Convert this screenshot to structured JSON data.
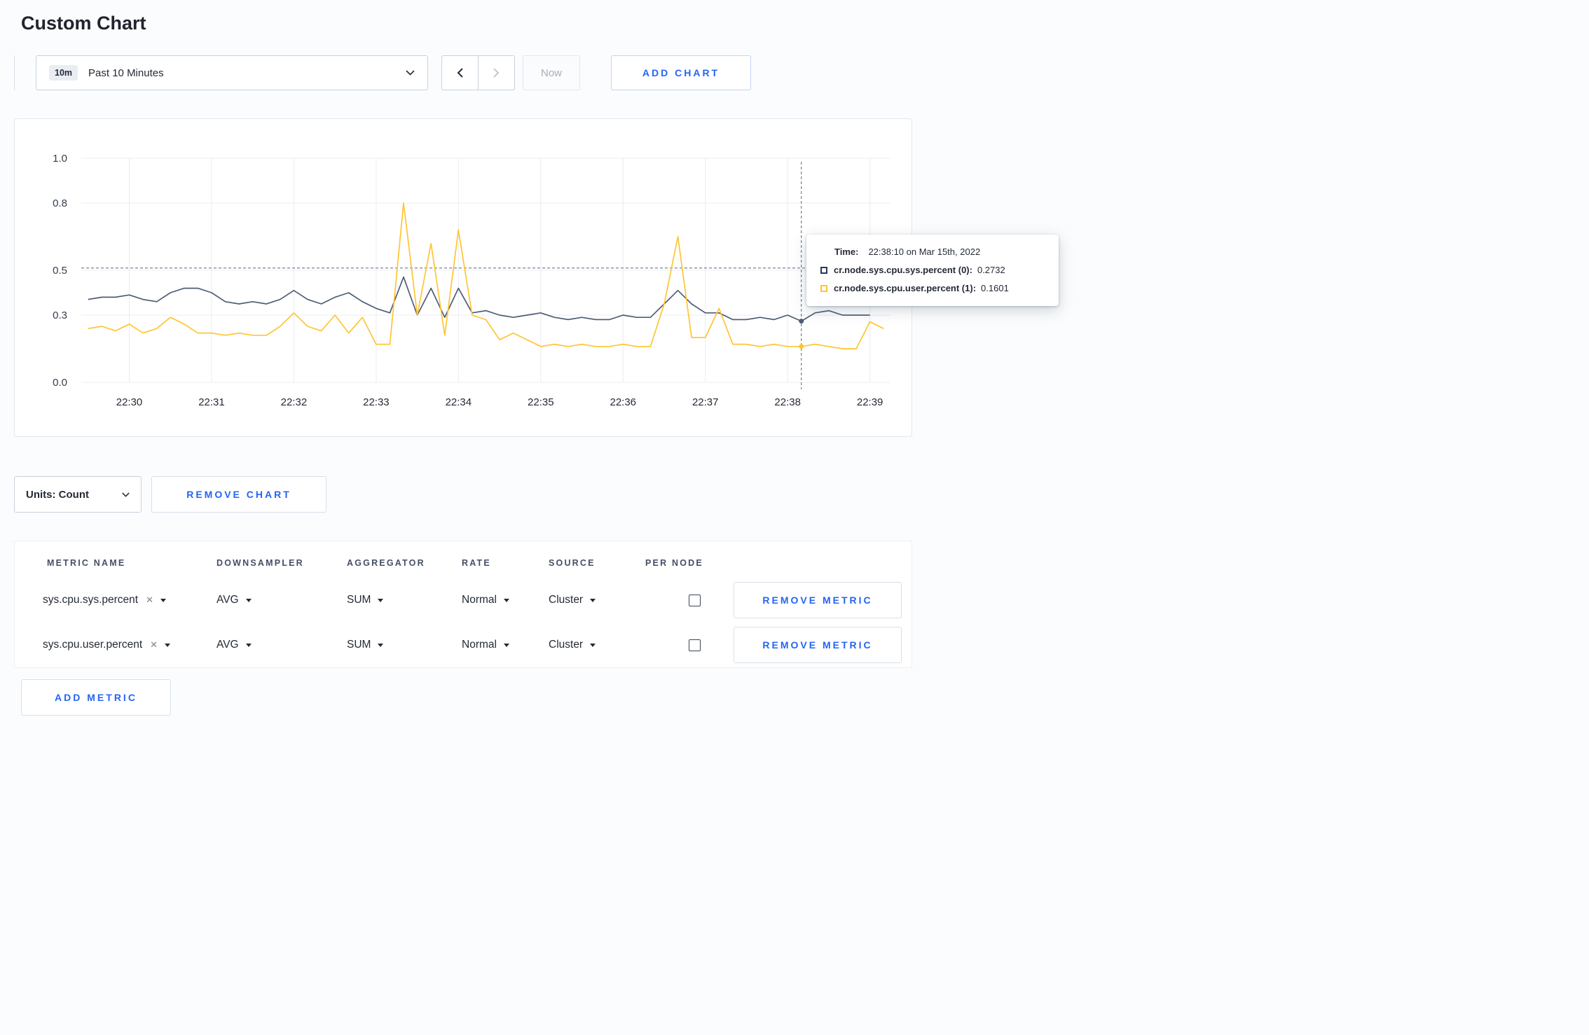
{
  "page": {
    "title": "Custom Chart"
  },
  "toolbar": {
    "time_window_badge": "10m",
    "time_window_label": "Past 10 Minutes",
    "now_label": "Now",
    "add_chart_label": "ADD CHART"
  },
  "chart_card": {
    "units_label": "Units: Count",
    "remove_chart_label": "REMOVE CHART",
    "tooltip": {
      "time_label": "Time:",
      "time_value": "22:38:10 on Mar 15th, 2022",
      "series": [
        {
          "label": "cr.node.sys.cpu.sys.percent (0):",
          "value": "0.2732",
          "color": "#283a57"
        },
        {
          "label": "cr.node.sys.cpu.user.percent (1):",
          "value": "0.1601",
          "color": "#ffc533"
        }
      ]
    }
  },
  "chart_data": {
    "type": "line",
    "title": "",
    "xlabel": "",
    "ylabel": "",
    "ylim": [
      0,
      1
    ],
    "yticks": [
      0.0,
      0.3,
      0.5,
      0.8,
      1.0
    ],
    "ytick_labels": [
      "0.0",
      "0.3",
      "0.5",
      "0.8",
      "1.0"
    ],
    "xticks": [
      "22:30",
      "22:31",
      "22:32",
      "22:33",
      "22:34",
      "22:35",
      "22:36",
      "22:37",
      "22:38",
      "22:39"
    ],
    "x_domain": [
      "22:29:25",
      "22:39:15"
    ],
    "grid": true,
    "legend_position": "none",
    "x": [
      "22:29:30",
      "22:29:40",
      "22:29:50",
      "22:30:00",
      "22:30:10",
      "22:30:20",
      "22:30:30",
      "22:30:40",
      "22:30:50",
      "22:31:00",
      "22:31:10",
      "22:31:20",
      "22:31:30",
      "22:31:40",
      "22:31:50",
      "22:32:00",
      "22:32:10",
      "22:32:20",
      "22:32:30",
      "22:32:40",
      "22:32:50",
      "22:33:00",
      "22:33:10",
      "22:33:20",
      "22:33:30",
      "22:33:40",
      "22:33:50",
      "22:34:00",
      "22:34:10",
      "22:34:20",
      "22:34:30",
      "22:34:40",
      "22:34:50",
      "22:35:00",
      "22:35:10",
      "22:35:20",
      "22:35:30",
      "22:35:40",
      "22:35:50",
      "22:36:00",
      "22:36:10",
      "22:36:20",
      "22:36:30",
      "22:36:40",
      "22:36:50",
      "22:37:00",
      "22:37:10",
      "22:37:20",
      "22:37:30",
      "22:37:40",
      "22:37:50",
      "22:38:00",
      "22:38:10",
      "22:38:20",
      "22:38:30",
      "22:38:40",
      "22:38:50",
      "22:39:00",
      "22:39:10"
    ],
    "series": [
      {
        "name": "cr.node.sys.cpu.sys.percent",
        "color": "#4f5d75",
        "values": [
          0.37,
          0.38,
          0.38,
          0.39,
          0.37,
          0.36,
          0.4,
          0.42,
          0.42,
          0.4,
          0.36,
          0.35,
          0.36,
          0.35,
          0.37,
          0.41,
          0.37,
          0.35,
          0.38,
          0.4,
          0.36,
          0.33,
          0.31,
          0.47,
          0.3,
          0.42,
          0.29,
          0.42,
          0.31,
          0.32,
          0.3,
          0.29,
          0.3,
          0.31,
          0.29,
          0.28,
          0.29,
          0.28,
          0.28,
          0.3,
          0.29,
          0.29,
          0.35,
          0.41,
          0.35,
          0.31,
          0.31,
          0.28,
          0.28,
          0.29,
          0.28,
          0.3,
          0.2732,
          0.31,
          0.32,
          0.3,
          0.3,
          0.3,
          null
        ]
      },
      {
        "name": "cr.node.sys.cpu.user.percent",
        "color": "#ffc533",
        "values": [
          0.24,
          0.25,
          0.23,
          0.26,
          0.22,
          0.24,
          0.29,
          0.26,
          0.22,
          0.22,
          0.21,
          0.22,
          0.21,
          0.21,
          0.25,
          0.31,
          0.25,
          0.23,
          0.3,
          0.22,
          0.29,
          0.17,
          0.17,
          0.8,
          0.3,
          0.62,
          0.21,
          0.68,
          0.3,
          0.28,
          0.19,
          0.22,
          0.19,
          0.16,
          0.17,
          0.16,
          0.17,
          0.16,
          0.16,
          0.17,
          0.16,
          0.16,
          0.35,
          0.65,
          0.2,
          0.2,
          0.33,
          0.17,
          0.17,
          0.16,
          0.17,
          0.16,
          0.1601,
          0.17,
          0.16,
          0.15,
          0.15,
          0.27,
          0.24
        ]
      }
    ],
    "crosshair": {
      "x": "22:38:10",
      "hline_y": 0.51,
      "points": [
        0.2732,
        0.1601
      ]
    }
  },
  "metrics_table": {
    "headers": [
      "METRIC NAME",
      "DOWNSAMPLER",
      "AGGREGATOR",
      "RATE",
      "SOURCE",
      "PER NODE"
    ],
    "rows": [
      {
        "metric": "sys.cpu.sys.percent",
        "downsampler": "AVG",
        "aggregator": "SUM",
        "rate": "Normal",
        "source": "Cluster",
        "per_node": false,
        "remove_label": "REMOVE METRIC"
      },
      {
        "metric": "sys.cpu.user.percent",
        "downsampler": "AVG",
        "aggregator": "SUM",
        "rate": "Normal",
        "source": "Cluster",
        "per_node": false,
        "remove_label": "REMOVE METRIC"
      }
    ],
    "add_metric_label": "ADD METRIC"
  }
}
